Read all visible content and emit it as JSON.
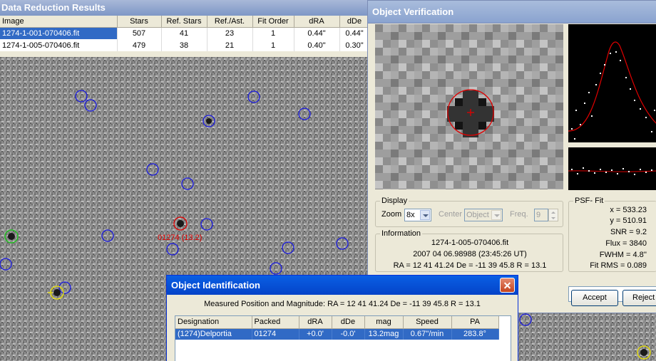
{
  "data_reduction": {
    "title": "Data Reduction Results",
    "columns": [
      "Image",
      "Stars",
      "Ref. Stars",
      "Ref./Ast.",
      "Fit Order",
      "dRA",
      "dDe"
    ],
    "rows": [
      [
        "1274-1-001-070406.fit",
        "507",
        "41",
        "23",
        "1",
        "0.44\"",
        "0.44\""
      ],
      [
        "1274-1-005-070406.fit",
        "479",
        "38",
        "21",
        "1",
        "0.40\"",
        "0.30\""
      ]
    ]
  },
  "field": {
    "object_label": "01274 (13.2)"
  },
  "verification": {
    "title": "Object Verification",
    "display": {
      "label": "Display",
      "zoom_label": "Zoom",
      "zoom_value": "8x",
      "center_label": "Center",
      "center_value": "Object",
      "freq_label": "Freq.",
      "freq_value": "9"
    },
    "information": {
      "label": "Information",
      "file": "1274-1-005-070406.fit",
      "time": "2007 04 06.98988 (23:45:26 UT)",
      "position": "RA = 12 41 41.24   De = -11 39 45.8   R = 13.1"
    },
    "psf_fit": {
      "label": "PSF- Fit",
      "x": "x = 533.23",
      "y": "y = 510.91",
      "snr": "SNR = 9.2",
      "flux": "Flux = 3840",
      "fwhm": "FWHM = 4.8''",
      "fit_rms": "Fit RMS = 0.089"
    },
    "accept_label": "Accept",
    "reject_label": "Reject"
  },
  "identification": {
    "title": "Object Identification",
    "measured": "Measured Position and Magnitude: RA = 12 41 41.24   De = -11 39 45.8   R = 13.1",
    "columns": [
      "Designation",
      "Packed",
      "dRA",
      "dDe",
      "mag",
      "Speed",
      "PA"
    ],
    "rows": [
      [
        "(1274)Delportia",
        "01274",
        "+0.0'",
        "-0.0'",
        "13.2mag",
        "0.67''/min",
        "283.8°"
      ]
    ]
  },
  "colors": {
    "selection": "#316ac5",
    "marker_blue": "#1818e0",
    "marker_red": "#e00000",
    "marker_green": "#20c020",
    "marker_yellow": "#e8e000"
  }
}
